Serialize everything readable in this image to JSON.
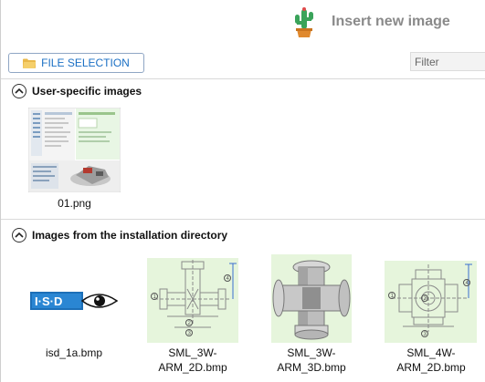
{
  "header": {
    "title": "Insert new image",
    "icon": "cactus-icon"
  },
  "toolbar": {
    "file_selection_label": "FILE SELECTION",
    "filter_placeholder": "Filter"
  },
  "sections": {
    "user": {
      "title": "User-specific images",
      "items": [
        {
          "caption": "01.png"
        }
      ]
    },
    "install": {
      "title": "Images from the installation directory",
      "items": [
        {
          "caption": "isd_1a.bmp"
        },
        {
          "caption_line1": "SML_3W-",
          "caption_line2": "ARM_2D.bmp"
        },
        {
          "caption_line1": "SML_3W-",
          "caption_line2": "ARM_3D.bmp"
        },
        {
          "caption_line1": "SML_4W-",
          "caption_line2": "ARM_2D.bmp"
        }
      ]
    }
  },
  "colors": {
    "accent": "#1a6fc4",
    "title_gray": "#8a8a8a",
    "thumb_bg": "#e6f5dc"
  }
}
